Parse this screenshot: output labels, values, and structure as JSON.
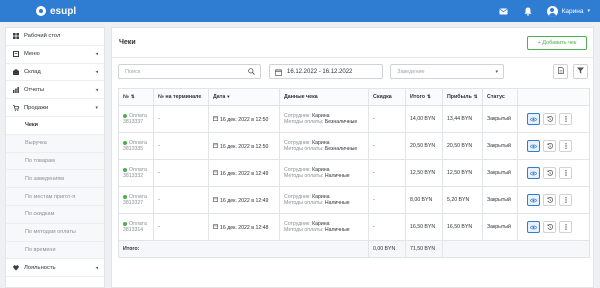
{
  "app": {
    "brand": "esupl",
    "user_name": "Карина"
  },
  "sidebar": {
    "items": [
      {
        "label": "Рабочий стол",
        "icon": "dashboard-icon",
        "arrow": ""
      },
      {
        "label": "Меню",
        "icon": "menu-book-icon",
        "arrow": "◂"
      },
      {
        "label": "Склад",
        "icon": "warehouse-icon",
        "arrow": "◂"
      },
      {
        "label": "Отчеты",
        "icon": "reports-icon",
        "arrow": "◂"
      },
      {
        "label": "Продажи",
        "icon": "cart-icon",
        "arrow": "▾"
      }
    ],
    "subitems": [
      {
        "label": "Чеки",
        "active": true
      },
      {
        "label": "Выручка"
      },
      {
        "label": "По товарам"
      },
      {
        "label": "По заведениям"
      },
      {
        "label": "По местам пригот-я"
      },
      {
        "label": "По скидкам"
      },
      {
        "label": "По методам оплаты"
      },
      {
        "label": "По времени"
      }
    ],
    "bottom": [
      {
        "label": "Лояльность",
        "icon": "heart-icon",
        "arrow": "◂"
      }
    ]
  },
  "page": {
    "title": "Чеки",
    "add_button": "+ Добавить чек",
    "search_placeholder": "Поиск",
    "date_range": "16.12.2022 - 16.12.2022",
    "venue_placeholder": "Заведение"
  },
  "table": {
    "headers": {
      "num": "№",
      "terminal": "№ на терминале",
      "date": "Дата",
      "details": "Данные чека",
      "discount": "Скидка",
      "total": "Итого",
      "profit": "Прибыль",
      "status": "Статус"
    },
    "rows": [
      {
        "paid": "Оплата",
        "id": "3813337",
        "terminal": "-",
        "date": "16 дек. 2022 в 12:50",
        "employee_label": "Сотрудник:",
        "employee": "Карина",
        "method_label": "Методы оплаты:",
        "method": "Безналичные",
        "discount": "-",
        "total": "14,00 BYN",
        "profit": "13,44 BYN",
        "status": "Закрытый"
      },
      {
        "paid": "Оплата",
        "id": "3813335",
        "terminal": "-",
        "date": "16 дек. 2022 в 12:50",
        "employee_label": "Сотрудник:",
        "employee": "Карина",
        "method_label": "Методы оплаты:",
        "method": "Безналичные",
        "discount": "-",
        "total": "20,50 BYN",
        "profit": "20,50 BYN",
        "status": "Закрытый"
      },
      {
        "paid": "Оплата",
        "id": "3813332",
        "terminal": "-",
        "date": "16 дек. 2022 в 12:49",
        "employee_label": "Сотрудник:",
        "employee": "Карина",
        "method_label": "Методы оплаты:",
        "method": "Наличные",
        "discount": "-",
        "total": "12,50 BYN",
        "profit": "12,50 BYN",
        "status": "Закрытый"
      },
      {
        "paid": "Оплата",
        "id": "3813327",
        "terminal": "-",
        "date": "16 дек. 2022 в 12:49",
        "employee_label": "Сотрудник:",
        "employee": "Карина",
        "method_label": "Методы оплаты:",
        "method": "Наличные",
        "discount": "-",
        "total": "8,00 BYN",
        "profit": "5,20 BYN",
        "status": "Закрытый"
      },
      {
        "paid": "Оплата",
        "id": "3813314",
        "terminal": "-",
        "date": "16 дек. 2022 в 12:48",
        "employee_label": "Сотрудник:",
        "employee": "Карина",
        "method_label": "Методы оплаты:",
        "method": "Наличные",
        "discount": "-",
        "total": "16,50 BYN",
        "profit": "16,50 BYN",
        "status": "Закрытый"
      }
    ],
    "totals": {
      "label": "Итого:",
      "discount": "0,00 BYN",
      "total": "71,50 BYN"
    }
  }
}
